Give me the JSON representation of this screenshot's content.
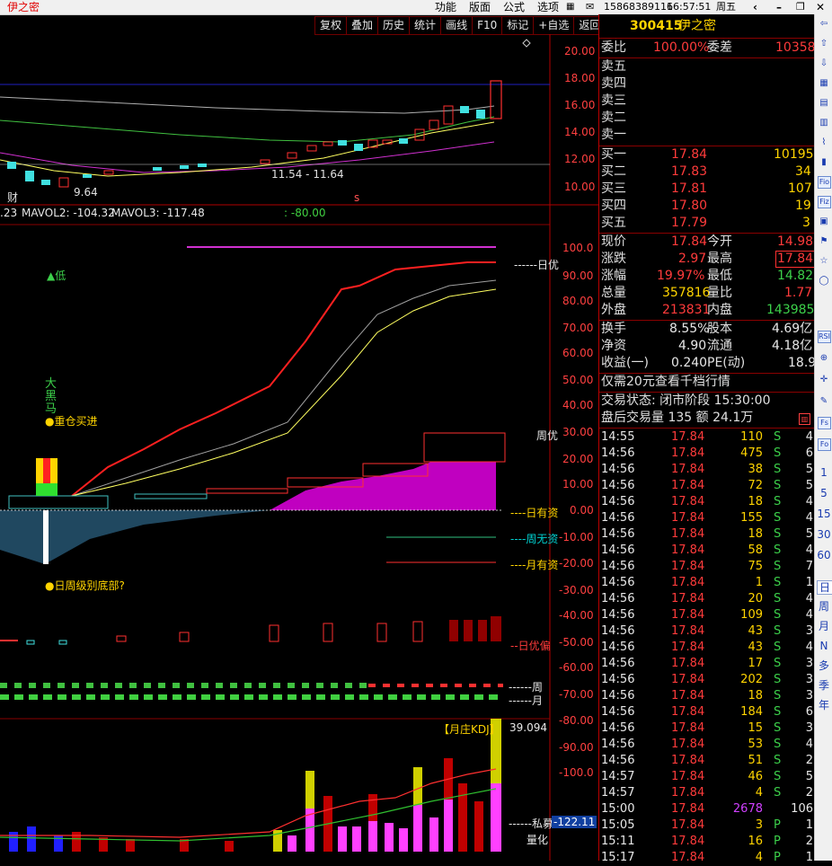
{
  "titlebar": {
    "app_title": "伊之密",
    "menus": [
      "功能",
      "版面",
      "公式",
      "选项"
    ],
    "account": "15868389116",
    "time": "16:57:51",
    "weekday": "周五"
  },
  "toolbar": [
    "复权",
    "叠加",
    "历史",
    "统计",
    "画线",
    "F10",
    "标记",
    "+自选",
    "返回"
  ],
  "stock": {
    "code": "300415",
    "name": "伊之密"
  },
  "price_chart": {
    "range_label": "11.54 - 11.64",
    "low_label": "9.64",
    "cai_label": "财",
    "s_label": "s",
    "y_ticks": [
      "20.00",
      "18.00",
      "16.00",
      "14.00",
      "12.00",
      "10.00"
    ]
  },
  "mavol": {
    "mavol2": "MAVOL2: -104.32",
    "mavol3": "MAVOL3: -117.48",
    "left": ".23",
    "extra": ": -80.00"
  },
  "indicator": {
    "y_ticks": [
      "100.0",
      "90.00",
      "80.00",
      "70.00",
      "60.00",
      "50.00",
      "40.00",
      "30.00",
      "20.00",
      "10.00",
      "0.00",
      "-10.00",
      "-20.00",
      "-30.00",
      "-40.00",
      "-50.00",
      "-60.00",
      "-70.00",
      "-80.00",
      "-90.00",
      "-100.0"
    ],
    "low_marker": "▲低",
    "big_black_horse": [
      "大",
      "黑",
      "马"
    ],
    "heavy_buy": "●重仓买进",
    "week_month_bottom": "●日周级别底部?",
    "right_labels": {
      "day_excellent": "------日优",
      "week_excellent": "周优",
      "day_fund": "----日有资",
      "week_no_fund": "----周无资",
      "month_fund": "----月有资",
      "day_excellent_2": "--日优偏",
      "week": "------周",
      "month": "------月"
    }
  },
  "kdj": {
    "title": "【月庄KDJ】",
    "value": "39.094",
    "private_label": "------私募",
    "private_value": "-122.11",
    "quant_label": "量化"
  },
  "quote": {
    "weibi_label": "委比",
    "weibi_value": "100.00%",
    "weicha_label": "委差",
    "weicha_value": "10358",
    "sell": [
      {
        "label": "卖五"
      },
      {
        "label": "卖四"
      },
      {
        "label": "卖三"
      },
      {
        "label": "卖二"
      },
      {
        "label": "卖一"
      }
    ],
    "buy": [
      {
        "label": "买一",
        "price": "17.84",
        "vol": "10195"
      },
      {
        "label": "买二",
        "price": "17.83",
        "vol": "34"
      },
      {
        "label": "买三",
        "price": "17.81",
        "vol": "107"
      },
      {
        "label": "买四",
        "price": "17.80",
        "vol": "19"
      },
      {
        "label": "买五",
        "price": "17.79",
        "vol": "3"
      }
    ],
    "stats": [
      {
        "l1": "现价",
        "v1": "17.84",
        "l2": "今开",
        "v2": "14.98"
      },
      {
        "l1": "涨跌",
        "v1": "2.97",
        "l2": "最高",
        "v2": "17.84"
      },
      {
        "l1": "涨幅",
        "v1": "19.97%",
        "l2": "最低",
        "v2": "14.82"
      },
      {
        "l1": "总量",
        "v1": "357816",
        "l2": "量比",
        "v2": "1.77"
      },
      {
        "l1": "外盘",
        "v1": "213831",
        "l2": "内盘",
        "v2": "143985"
      },
      {
        "l1": "换手",
        "v1": "8.55%",
        "l2": "股本",
        "v2": "4.69亿"
      },
      {
        "l1": "净资",
        "v1": "4.90",
        "l2": "流通",
        "v2": "4.18亿"
      },
      {
        "l1": "收益(一)",
        "v1": "0.240",
        "l2": "PE(动)",
        "v2": "18.9"
      }
    ],
    "promo": "仅需20元查看千档行情",
    "trade_status": "交易状态: 闭市阶段 15:30:00",
    "after_hours": "盘后交易量 135 额 24.1万",
    "ticks": [
      {
        "t": "14:55",
        "p": "17.84",
        "v": "110",
        "d": "S",
        "n": "4"
      },
      {
        "t": "14:56",
        "p": "17.84",
        "v": "475",
        "d": "S",
        "n": "6"
      },
      {
        "t": "14:56",
        "p": "17.84",
        "v": "38",
        "d": "S",
        "n": "5"
      },
      {
        "t": "14:56",
        "p": "17.84",
        "v": "72",
        "d": "S",
        "n": "5"
      },
      {
        "t": "14:56",
        "p": "17.84",
        "v": "18",
        "d": "S",
        "n": "4"
      },
      {
        "t": "14:56",
        "p": "17.84",
        "v": "155",
        "d": "S",
        "n": "4"
      },
      {
        "t": "14:56",
        "p": "17.84",
        "v": "18",
        "d": "S",
        "n": "5"
      },
      {
        "t": "14:56",
        "p": "17.84",
        "v": "58",
        "d": "S",
        "n": "4"
      },
      {
        "t": "14:56",
        "p": "17.84",
        "v": "75",
        "d": "S",
        "n": "7"
      },
      {
        "t": "14:56",
        "p": "17.84",
        "v": "1",
        "d": "S",
        "n": "1"
      },
      {
        "t": "14:56",
        "p": "17.84",
        "v": "20",
        "d": "S",
        "n": "4"
      },
      {
        "t": "14:56",
        "p": "17.84",
        "v": "109",
        "d": "S",
        "n": "4"
      },
      {
        "t": "14:56",
        "p": "17.84",
        "v": "43",
        "d": "S",
        "n": "3"
      },
      {
        "t": "14:56",
        "p": "17.84",
        "v": "43",
        "d": "S",
        "n": "4"
      },
      {
        "t": "14:56",
        "p": "17.84",
        "v": "17",
        "d": "S",
        "n": "3"
      },
      {
        "t": "14:56",
        "p": "17.84",
        "v": "202",
        "d": "S",
        "n": "3"
      },
      {
        "t": "14:56",
        "p": "17.84",
        "v": "18",
        "d": "S",
        "n": "3"
      },
      {
        "t": "14:56",
        "p": "17.84",
        "v": "184",
        "d": "S",
        "n": "6"
      },
      {
        "t": "14:56",
        "p": "17.84",
        "v": "15",
        "d": "S",
        "n": "3"
      },
      {
        "t": "14:56",
        "p": "17.84",
        "v": "53",
        "d": "S",
        "n": "4"
      },
      {
        "t": "14:56",
        "p": "17.84",
        "v": "51",
        "d": "S",
        "n": "2"
      },
      {
        "t": "14:57",
        "p": "17.84",
        "v": "46",
        "d": "S",
        "n": "5"
      },
      {
        "t": "14:57",
        "p": "17.84",
        "v": "4",
        "d": "S",
        "n": "2"
      },
      {
        "t": "15:00",
        "p": "17.84",
        "v": "2678",
        "d": "",
        "n": "106"
      },
      {
        "t": "15:05",
        "p": "17.84",
        "v": "3",
        "d": "P",
        "n": "1"
      },
      {
        "t": "15:11",
        "p": "17.84",
        "v": "16",
        "d": "P",
        "n": "2"
      },
      {
        "t": "15:17",
        "p": "17.84",
        "v": "4",
        "d": "P",
        "n": "1"
      }
    ]
  },
  "sidebar_labels": [
    "1",
    "5",
    "15",
    "30",
    "60",
    "日",
    "周",
    "月",
    "N",
    "多",
    "季",
    "年"
  ],
  "sidebar_icons": [
    "RSI",
    "Fs",
    "Fio",
    "Fiz"
  ]
}
